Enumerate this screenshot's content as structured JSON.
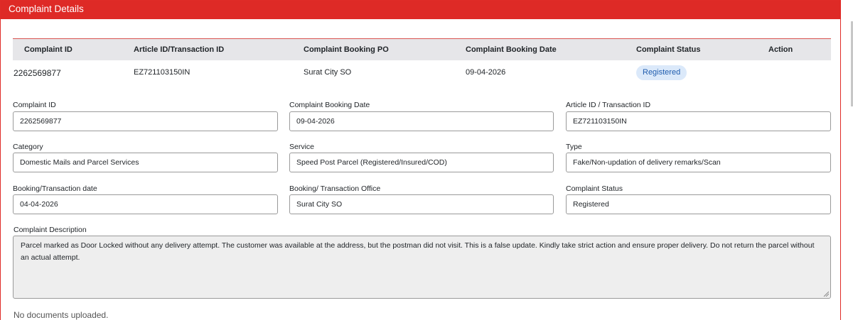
{
  "header": {
    "title": "Complaint Details"
  },
  "table": {
    "columns": [
      "Complaint ID",
      "Article ID/Transaction ID",
      "Complaint Booking PO",
      "Complaint Booking Date",
      "Complaint Status",
      "Action"
    ],
    "row": {
      "complaint_id": "2262569877",
      "article_id": "EZ721103150IN",
      "booking_po": "Surat City SO",
      "booking_date": "09-04-2026",
      "status": "Registered"
    }
  },
  "form": {
    "complaint_id": {
      "label": "Complaint ID",
      "value": "2262569877"
    },
    "booking_date": {
      "label": "Complaint Booking Date",
      "value": "09-04-2026"
    },
    "article_id": {
      "label": "Article ID / Transaction ID",
      "value": "EZ721103150IN"
    },
    "category": {
      "label": "Category",
      "value": "Domestic Mails and Parcel Services"
    },
    "service": {
      "label": "Service",
      "value": "Speed Post Parcel (Registered/Insured/COD)"
    },
    "type": {
      "label": "Type",
      "value": "Fake/Non-updation of delivery remarks/Scan"
    },
    "transaction_date": {
      "label": "Booking/Transaction date",
      "value": "04-04-2026"
    },
    "transaction_office": {
      "label": "Booking/ Transaction Office",
      "value": "Surat City SO"
    },
    "status": {
      "label": "Complaint Status",
      "value": "Registered"
    },
    "description": {
      "label": "Complaint Description",
      "value": "Parcel marked as Door Locked without any delivery attempt. The customer was available at the address, but the postman did not visit. This is a false update. Kindly take strict action and ensure proper delivery. Do not return the parcel without an actual attempt."
    }
  },
  "documents": {
    "empty_text": "No documents uploaded."
  },
  "colors": {
    "header_red": "#de2a26",
    "badge_bg": "#dbe9fa",
    "badge_text": "#1f5cae",
    "readonly_bg": "#eeeeee"
  }
}
